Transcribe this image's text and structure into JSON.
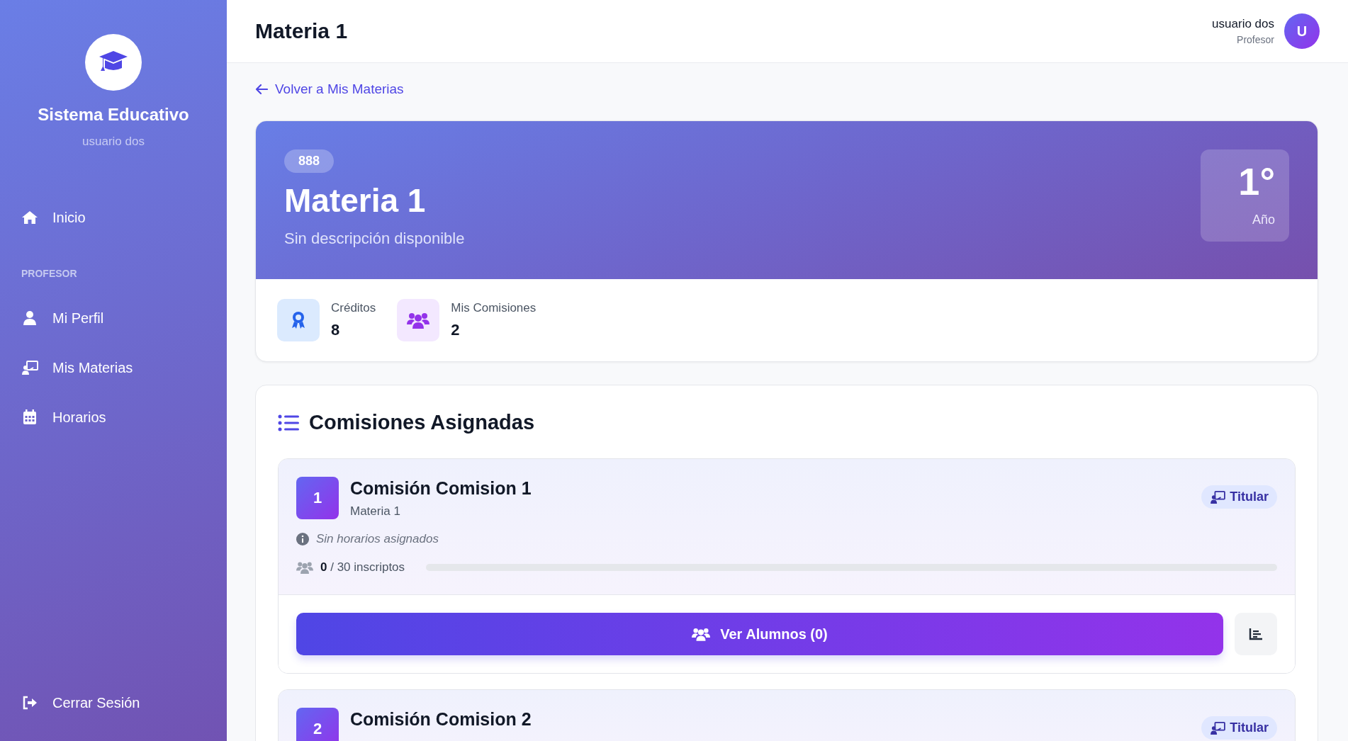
{
  "sidebar": {
    "brand": "Sistema Educativo",
    "user": "usuario dos",
    "items": [
      {
        "kind": "home",
        "label": "Inicio",
        "selected": false
      }
    ],
    "section": "PROFESOR",
    "section_items": [
      {
        "kind": "user",
        "label": "Mi Perfil",
        "selected": false
      },
      {
        "kind": "teach",
        "label": "Mis Materias",
        "selected": false
      },
      {
        "kind": "calendar",
        "label": "Horarios",
        "selected": false
      }
    ],
    "logout": "Cerrar Sesión"
  },
  "header": {
    "title": "Materia 1",
    "user_name": "usuario dos",
    "user_role": "Profesor",
    "avatar": "U"
  },
  "back_link": "Volver a Mis Materias",
  "subject": {
    "code": "888",
    "title": "Materia 1",
    "description": "Sin descripción disponible",
    "year": "1°",
    "year_label": "Año",
    "stats": [
      {
        "kind": "credits",
        "label": "Créditos",
        "value": "8"
      },
      {
        "kind": "commissions",
        "label": "Mis Comisiones",
        "value": "2"
      }
    ]
  },
  "commissions": {
    "title": "Comisiones Asignadas",
    "items": [
      {
        "number": "1",
        "title": "Comisión Comision 1",
        "subject": "Materia 1",
        "schedule_note": "Sin horarios asignados",
        "enrolled": "0",
        "capacity_text": "/ 30 inscriptos",
        "level": 0,
        "role": "Titular",
        "button": "Ver Alumnos (0)"
      },
      {
        "number": "2",
        "title": "Comisión Comision 2",
        "role": "Titular"
      }
    ]
  }
}
